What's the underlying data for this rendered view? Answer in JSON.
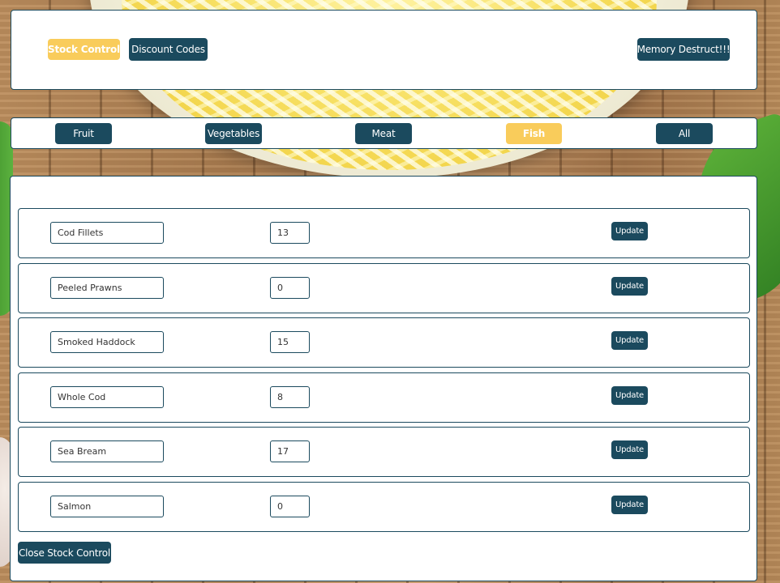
{
  "nav": {
    "stock_control": "Stock Control",
    "discount_codes": "Discount Codes",
    "memory_destruct": "Memory Destruct!!!"
  },
  "categories": [
    {
      "label": "Fruit",
      "active": false
    },
    {
      "label": "Vegetables",
      "active": false
    },
    {
      "label": "Meat",
      "active": false
    },
    {
      "label": "Fish",
      "active": true
    },
    {
      "label": "All",
      "active": false
    }
  ],
  "stock": {
    "update_label": "Update",
    "items": [
      {
        "name": "Cod Fillets",
        "quantity": "13"
      },
      {
        "name": "Peeled Prawns",
        "quantity": "0"
      },
      {
        "name": "Smoked Haddock",
        "quantity": "15"
      },
      {
        "name": "Whole Cod",
        "quantity": "8"
      },
      {
        "name": "Sea Bream",
        "quantity": "17"
      },
      {
        "name": "Salmon",
        "quantity": "0"
      }
    ],
    "close_label": "Close Stock Control"
  },
  "colors": {
    "primary": "#1b4a5e",
    "active": "#f9cc5b"
  }
}
